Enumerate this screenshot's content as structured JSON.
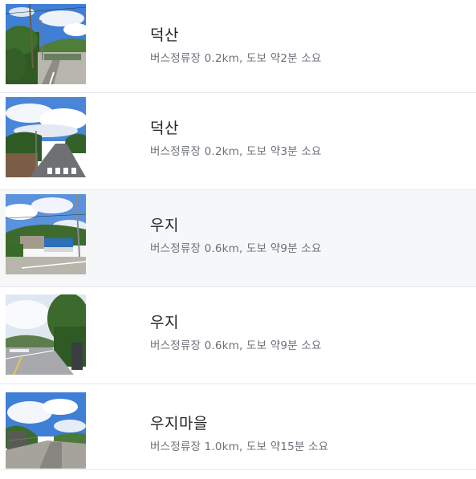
{
  "stops": [
    {
      "name": "덕산",
      "detail": "버스정류장 0.2km, 도보 약2분 소요",
      "selected": false
    },
    {
      "name": "덕산",
      "detail": "버스정류장 0.2km, 도보 약3분 소요",
      "selected": false
    },
    {
      "name": "우지",
      "detail": "버스정류장 0.6km, 도보 약9분 소요",
      "selected": true
    },
    {
      "name": "우지",
      "detail": "버스정류장 0.6km, 도보 약9분 소요",
      "selected": false
    },
    {
      "name": "우지마을",
      "detail": "버스정류장 1.0km, 도보 약15분 소요",
      "selected": false
    }
  ],
  "colors": {
    "row_highlight": "#f6f7f9",
    "divider": "#e6e8eb",
    "title_text": "#222427",
    "detail_text": "#6c7079"
  }
}
